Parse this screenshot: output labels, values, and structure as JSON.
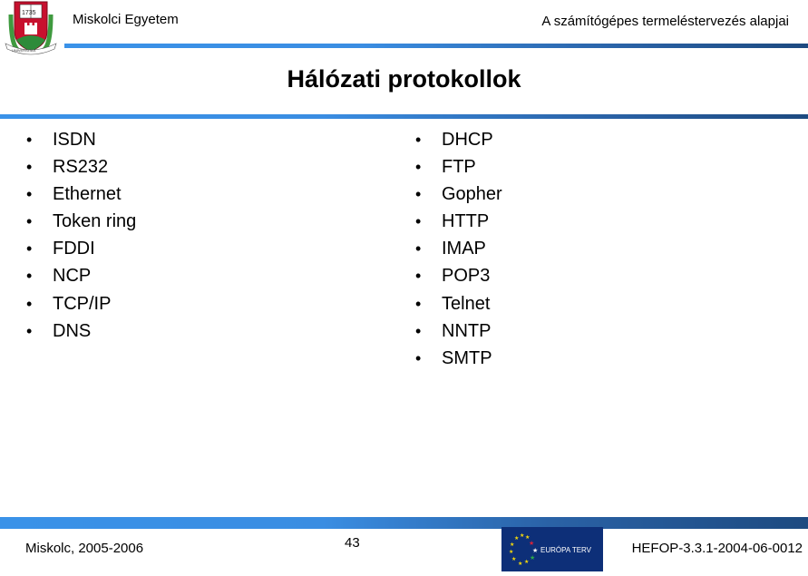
{
  "header": {
    "institution": "Miskolci Egyetem",
    "course": "A számítógépes termeléstervezés alapjai",
    "logo_icon": "university-crest-icon",
    "logo_year": "1735"
  },
  "slide": {
    "title": "Hálózati protokollok",
    "left_list": [
      "ISDN",
      "RS232",
      "Ethernet",
      "Token ring",
      "FDDI",
      "NCP",
      "TCP/IP",
      "DNS"
    ],
    "right_list": [
      "DHCP",
      "FTP",
      "Gopher",
      "HTTP",
      "IMAP",
      "POP3",
      "Telnet",
      "NNTP",
      "SMTP"
    ],
    "bullet": "•"
  },
  "footer": {
    "place_date": "Miskolc, 2005-2006",
    "page_number": "43",
    "eu_logo_text": "EURÓPA TERV",
    "eu_logo_icon": "eu-stars-icon",
    "project_code": "HEFOP-3.3.1-2004-06-0012"
  },
  "colors": {
    "bar_light": "#3a92e8",
    "bar_dark": "#1d4a80",
    "eu_blue": "#0d2f78",
    "crest_red": "#c8102e",
    "crest_green": "#2e8b3a"
  }
}
